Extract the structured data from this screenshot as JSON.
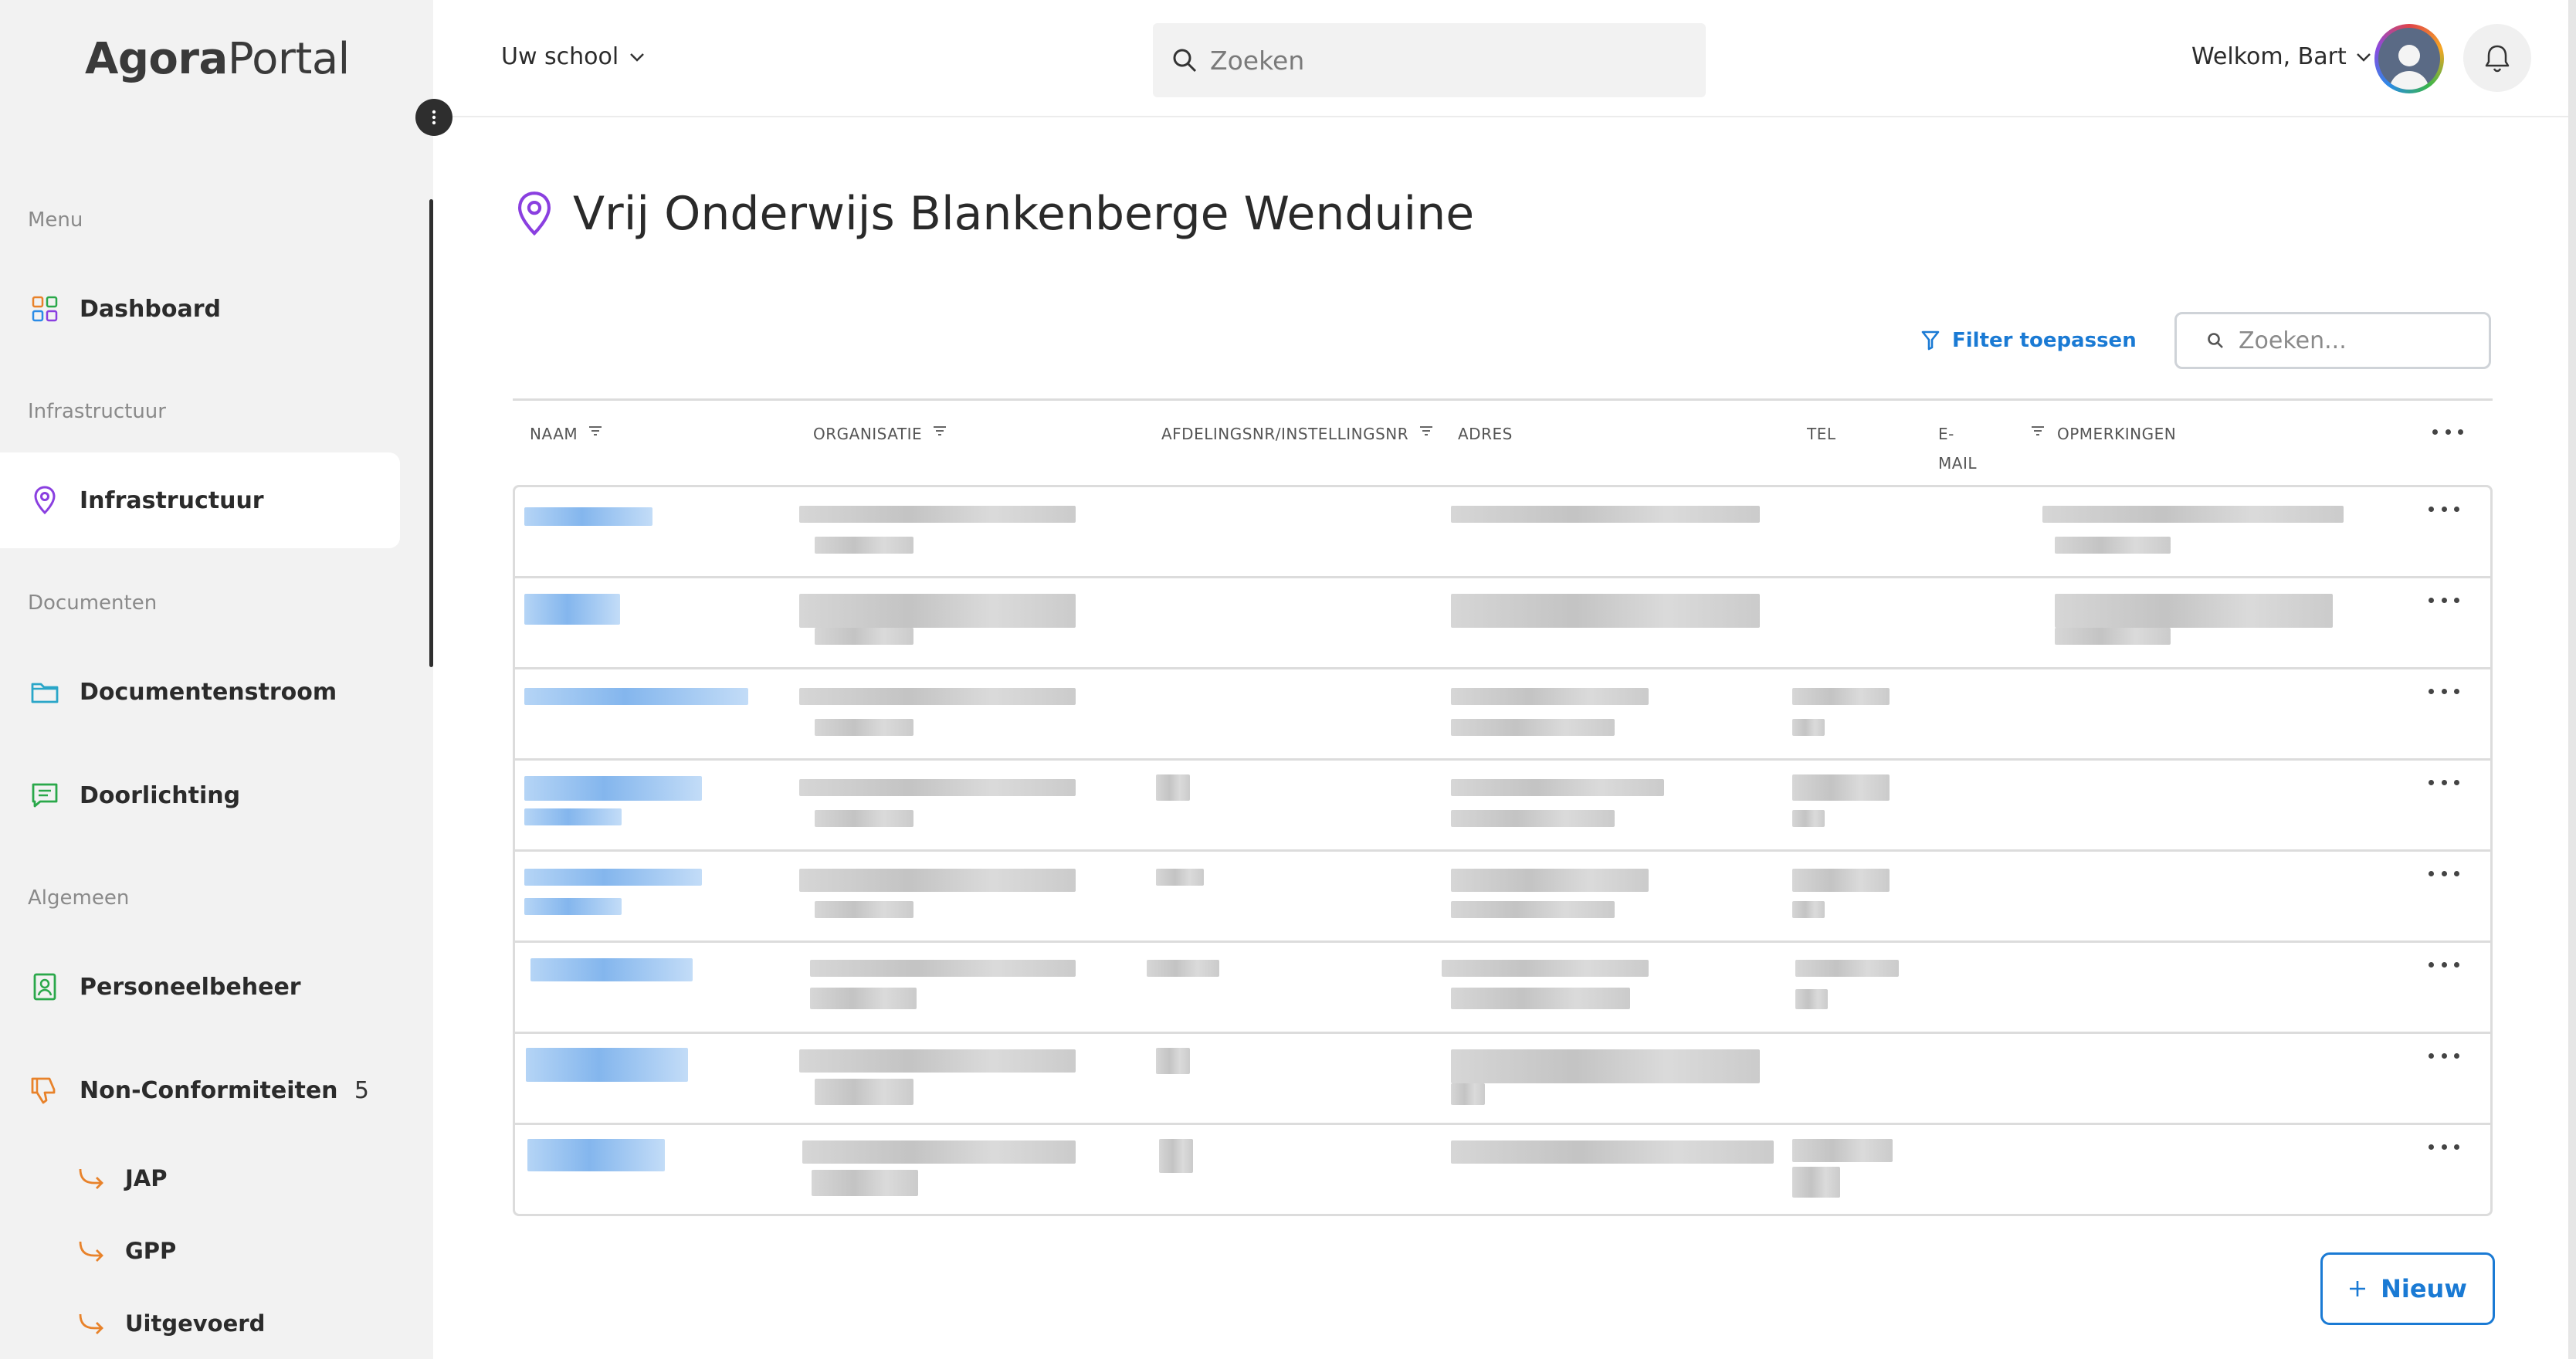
{
  "app": {
    "logo_bold": "Agora",
    "logo_light": "Portal"
  },
  "sidebar": {
    "sections": [
      {
        "label": "Menu"
      },
      {
        "label": "Infrastructuur"
      },
      {
        "label": "Documenten"
      },
      {
        "label": "Algemeen"
      }
    ],
    "items": [
      {
        "label": "Dashboard",
        "icon": "dashboard-grid-icon"
      },
      {
        "label": "Infrastructuur",
        "icon": "location-pin-icon",
        "active": true
      },
      {
        "label": "Documentenstroom",
        "icon": "folder-icon"
      },
      {
        "label": "Doorlichting",
        "icon": "message-icon"
      },
      {
        "label": "Personeelbeheer",
        "icon": "badge-icon"
      },
      {
        "label": "Non-Conformiteiten",
        "icon": "thumbs-down-icon",
        "count": "5"
      }
    ],
    "sub_items": [
      {
        "label": "JAP",
        "icon": "arrow-turn-right-icon"
      },
      {
        "label": "GPP",
        "icon": "arrow-turn-right-icon"
      },
      {
        "label": "Uitgevoerd",
        "icon": "arrow-turn-right-icon"
      }
    ]
  },
  "topbar": {
    "school_selector": "Uw school",
    "search_placeholder": "Zoeken",
    "welcome": "Welkom, Bart"
  },
  "main": {
    "title": "Vrij Onderwijs Blankenberge Wenduine",
    "filter_label": "Filter toepassen",
    "table_search_placeholder": "Zoeken...",
    "columns": [
      {
        "label": "NAAM",
        "sortable": true
      },
      {
        "label": "ORGANISATIE",
        "sortable": true
      },
      {
        "label": "AFDELINGSNR/INSTELLINGSNR",
        "sortable": true
      },
      {
        "label": "ADRES",
        "sortable": false
      },
      {
        "label": "TEL",
        "sortable": false
      },
      {
        "label": "E-",
        "label2": "MAIL",
        "sortable": true
      },
      {
        "label": "OPMERKINGEN",
        "sortable": false
      }
    ],
    "row_count": 8,
    "new_button": "Nieuw"
  },
  "colors": {
    "accent": "#1a7ad4",
    "pin": "#8a3fe0",
    "orange": "#e8822a",
    "green": "#2aa84a",
    "teal": "#2aa6c8"
  }
}
